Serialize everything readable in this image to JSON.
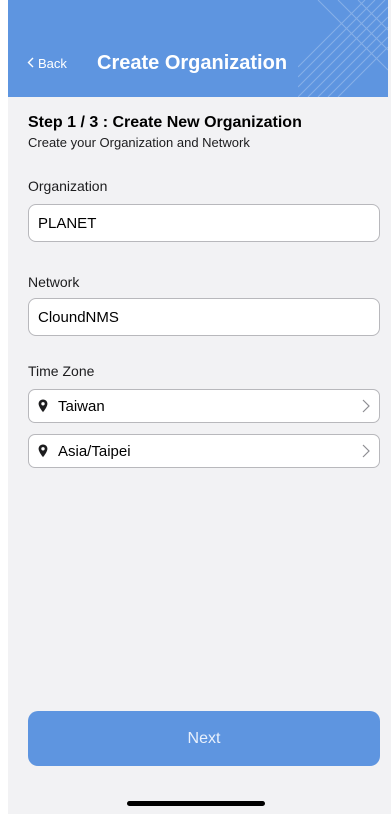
{
  "header": {
    "back_label": "Back",
    "title": "Create Organization",
    "color": "#5e95e0"
  },
  "step": {
    "heading": "Step 1 / 3 :  Create New Organization",
    "subtitle": "Create your Organization and Network"
  },
  "form": {
    "organization": {
      "label": "Organization",
      "value": "PLANET"
    },
    "network": {
      "label": "Network",
      "value": "CloundNMS"
    },
    "time_zone": {
      "label": "Time Zone",
      "region": "Taiwan",
      "zone": "Asia/Taipei"
    }
  },
  "footer": {
    "next_label": "Next"
  },
  "icons": {
    "back": "chevron-left-icon",
    "location": "location-pin-icon",
    "disclosure": "chevron-right-icon"
  }
}
